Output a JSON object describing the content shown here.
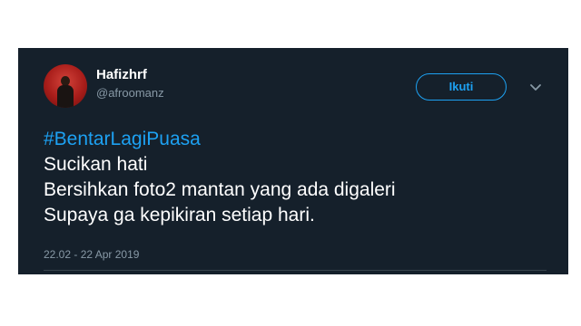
{
  "tweet": {
    "display_name": "Hafizhrf",
    "handle": "@afroomanz",
    "follow_label": "Ikuti",
    "hashtag": "#BentarLagiPuasa",
    "lines": [
      "Sucikan hati",
      "Bersihkan foto2 mantan yang ada digaleri",
      "Supaya ga kepikiran setiap hari."
    ],
    "timestamp": "22.02 - 22 Apr 2019"
  },
  "icons": {
    "more": "chevron-down-icon",
    "avatar": "user-avatar"
  },
  "colors": {
    "background": "#15202b",
    "accent": "#1da1f2",
    "muted_text": "#8899a6",
    "text": "#ffffff"
  }
}
